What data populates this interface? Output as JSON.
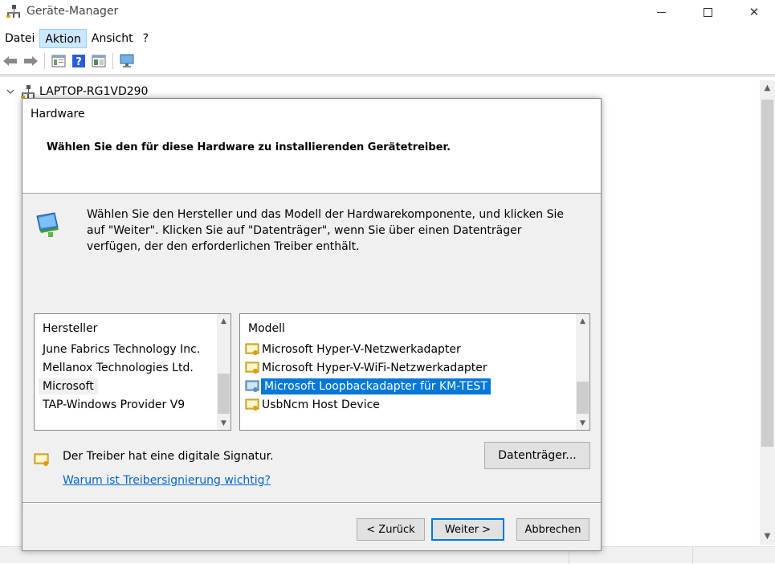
{
  "window": {
    "title": "Geräte-Manager",
    "controls": {
      "minimize_icon": "minimize-icon",
      "maximize_icon": "maximize-icon",
      "close": "✕"
    }
  },
  "menu": {
    "items": [
      "Datei",
      "Aktion",
      "Ansicht",
      "?"
    ],
    "active": "Aktion"
  },
  "toolbar": {
    "icons": [
      "back-arrow-icon",
      "forward-arrow-icon",
      "properties-icon",
      "help-icon",
      "view-pane-icon",
      "monitor-icon"
    ]
  },
  "tree": {
    "root_label": "LAPTOP-RG1VD290",
    "expanded_chevron": "⌄"
  },
  "dialog": {
    "title": "Hardware",
    "heading": "Wählen Sie den für diese Hardware zu installierenden Gerätetreiber.",
    "description": "Wählen Sie den Hersteller und das Modell der Hardwarekomponente, und klicken Sie auf \"Weiter\". Klicken Sie auf \"Datenträger\", wenn Sie über einen Datenträger verfügen, der den erforderlichen Treiber enthält.",
    "manufacturer": {
      "header": "Hersteller",
      "items": [
        "June Fabrics Technology Inc.",
        "Mellanox Technologies Ltd.",
        "Microsoft",
        "TAP-Windows Provider V9"
      ],
      "selected": "Microsoft"
    },
    "model": {
      "header": "Modell",
      "items": [
        "Microsoft Hyper-V-Netzwerkadapter",
        "Microsoft Hyper-V-WiFi-Netzwerkadapter",
        "Microsoft Loopbackadapter für KM-TEST",
        "UsbNcm Host Device"
      ],
      "selected": "Microsoft Loopbackadapter für KM-TEST"
    },
    "signature_text": "Der Treiber hat eine digitale Signatur.",
    "signature_link": "Warum ist Treibersignierung wichtig?",
    "buttons": {
      "disk": "Datenträger...",
      "back": "< Zurück",
      "next": "Weiter >",
      "cancel": "Abbrechen"
    }
  },
  "colors": {
    "selection": "#0078d7",
    "link": "#0066cc",
    "dialog_bg": "#f0f0f0",
    "menu_active_bg": "#cce8ff"
  }
}
